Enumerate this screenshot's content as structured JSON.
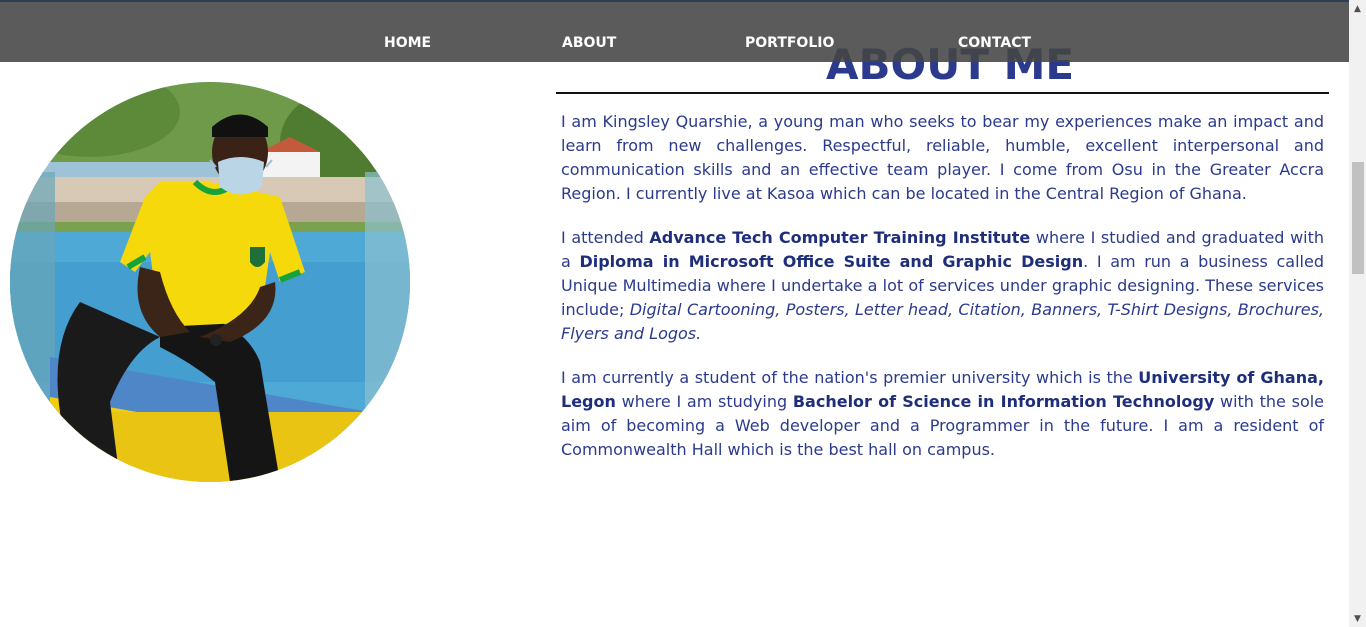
{
  "nav": {
    "items": [
      {
        "label": "HOME"
      },
      {
        "label": "ABOUT"
      },
      {
        "label": "PORTFOLIO"
      },
      {
        "label": "CONTACT"
      }
    ]
  },
  "about": {
    "title": "ABOUT ME",
    "p1": "I am Kingsley Quarshie, a young man who seeks to bear my experiences make an impact and learn from new challenges. Respectful, reliable, humble, excellent interpersonal and communication skills and an effective team player. I come from Osu in the Greater Accra Region. I currently live at Kasoa which can be located in the Central Region of Ghana.",
    "p2": {
      "t1": "I attended ",
      "b1": "Advance Tech Computer Training Institute",
      "t2": " where I studied and graduated with a ",
      "b2": "Diploma in Microsoft Office Suite and Graphic Design",
      "t3": ". I am run a business called Unique Multimedia where I undertake a lot of services under graphic designing. These services include; ",
      "i1": "Digital Cartooning, Posters, Letter head, Citation, Banners, T-Shirt Designs, Brochures, Flyers and Logos."
    },
    "p3": {
      "t1": "I am currently a student of the nation's premier university which is the ",
      "b1": "University of Ghana, Legon",
      "t2": " where I am studying ",
      "b2": "Bachelor of Science in Information Technology",
      "t3": " with the sole aim of becoming a Web developer and a Programmer in the future. I am a resident of Commonwealth Hall which is the best hall on campus."
    }
  },
  "colors": {
    "accent": "#2b3a8c",
    "navbar": "#4a4a4a",
    "shirt": "#f5d90a"
  },
  "icons": {
    "scroll_up": "scroll-up-arrow-icon",
    "scroll_down": "scroll-down-arrow-icon"
  }
}
